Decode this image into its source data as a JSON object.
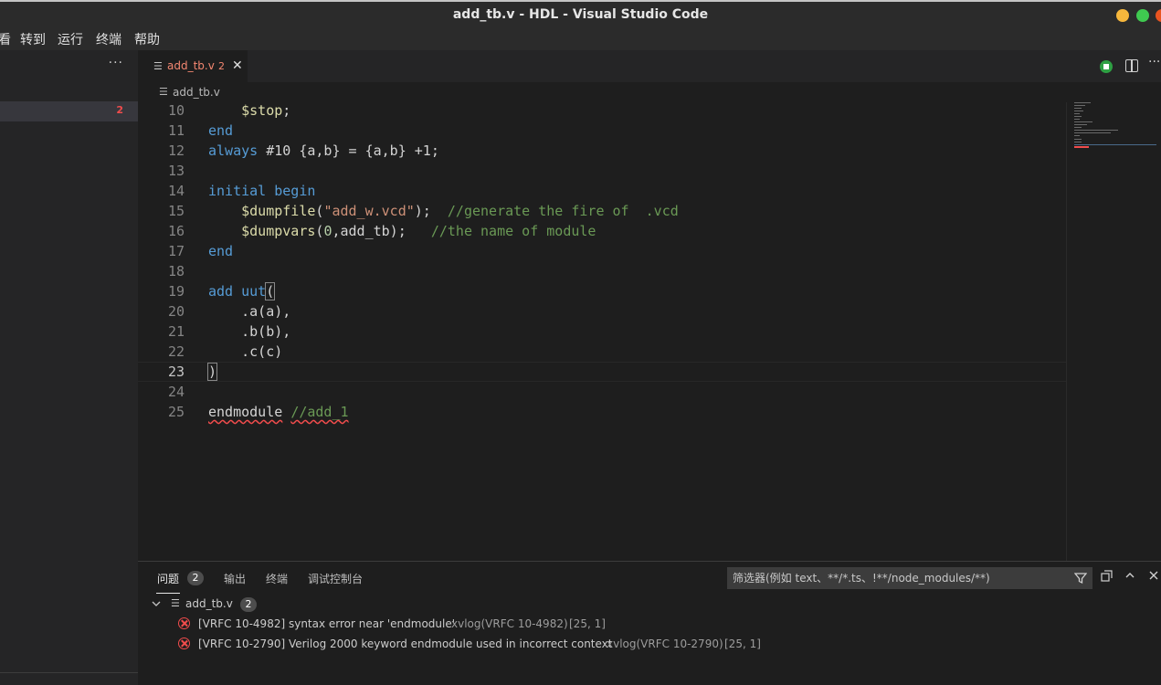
{
  "window": {
    "title": "add_tb.v - HDL - Visual Studio Code"
  },
  "menu": [
    "看",
    "转到",
    "运行",
    "终端",
    "帮助"
  ],
  "sidebar": {
    "more": "···",
    "error_count": "2"
  },
  "tab": {
    "icon": "file-lines-icon",
    "name": "add_tb.v",
    "badge": "2",
    "close": "✕"
  },
  "breadcrumb": {
    "icon": "file-lines-icon",
    "file": "add_tb.v"
  },
  "editor": {
    "current_line": 23,
    "lines": [
      {
        "n": "10",
        "tokens": [
          {
            "t": "    ",
            "c": "pl"
          },
          {
            "t": "$stop",
            "c": "fn"
          },
          {
            "t": ";",
            "c": "pl"
          }
        ]
      },
      {
        "n": "11",
        "tokens": [
          {
            "t": "end",
            "c": "kw"
          }
        ]
      },
      {
        "n": "12",
        "tokens": [
          {
            "t": "always",
            "c": "kw"
          },
          {
            "t": " #10 {a,b} = {a,b} +1;",
            "c": "pl"
          }
        ]
      },
      {
        "n": "13",
        "tokens": []
      },
      {
        "n": "14",
        "tokens": [
          {
            "t": "initial begin",
            "c": "kw"
          }
        ]
      },
      {
        "n": "15",
        "tokens": [
          {
            "t": "    ",
            "c": "pl"
          },
          {
            "t": "$dumpfile",
            "c": "fn"
          },
          {
            "t": "(",
            "c": "pl"
          },
          {
            "t": "\"add_w.vcd\"",
            "c": "str"
          },
          {
            "t": ");  ",
            "c": "pl"
          },
          {
            "t": "//generate the fire of  .vcd",
            "c": "cm"
          }
        ]
      },
      {
        "n": "16",
        "tokens": [
          {
            "t": "    ",
            "c": "pl"
          },
          {
            "t": "$dumpvars",
            "c": "fn"
          },
          {
            "t": "(",
            "c": "pl"
          },
          {
            "t": "0",
            "c": "num"
          },
          {
            "t": ",add_tb);   ",
            "c": "pl"
          },
          {
            "t": "//the name of module",
            "c": "cm"
          }
        ]
      },
      {
        "n": "17",
        "tokens": [
          {
            "t": "end",
            "c": "kw"
          }
        ]
      },
      {
        "n": "18",
        "tokens": []
      },
      {
        "n": "19",
        "tokens": [
          {
            "t": "add uut",
            "c": "kw"
          },
          {
            "t": "(",
            "c": "pl",
            "brk": true
          }
        ]
      },
      {
        "n": "20",
        "tokens": [
          {
            "t": "    .a(a),",
            "c": "pl"
          }
        ]
      },
      {
        "n": "21",
        "tokens": [
          {
            "t": "    .b(b),",
            "c": "pl"
          }
        ]
      },
      {
        "n": "22",
        "tokens": [
          {
            "t": "    .c(c)",
            "c": "pl"
          }
        ]
      },
      {
        "n": "23",
        "tokens": [
          {
            "t": ")",
            "c": "pl",
            "brk": true
          }
        ]
      },
      {
        "n": "24",
        "tokens": []
      },
      {
        "n": "25",
        "tokens": [
          {
            "t": "endmodule",
            "c": "pl",
            "squig": true
          },
          {
            "t": " ",
            "c": "pl"
          },
          {
            "t": "//add_1",
            "c": "cm",
            "squig": true
          }
        ]
      }
    ]
  },
  "panel": {
    "tabs": [
      "问题",
      "输出",
      "终端",
      "调试控制台"
    ],
    "problems_count": "2",
    "filter_placeholder": "筛选器(例如 text、**/*.ts、!**/node_modules/**)",
    "file_icon": "file-lines-icon",
    "file": "add_tb.v",
    "file_count": "2",
    "problems": [
      {
        "message": "[VRFC 10-4982] syntax error near 'endmodule'",
        "source": "xvlog(VRFC 10-4982)",
        "position": "[25, 1]"
      },
      {
        "message": "[VRFC 10-2790] Verilog 2000 keyword endmodule used in incorrect context",
        "source": "xvlog(VRFC 10-2790)",
        "position": "[25, 1]"
      }
    ]
  },
  "colors": {
    "accent_error": "#f14c4c",
    "keyword": "#569cd6",
    "function": "#dcdcaa",
    "string": "#ce9178",
    "comment": "#6a9955",
    "number": "#b5cea8"
  }
}
